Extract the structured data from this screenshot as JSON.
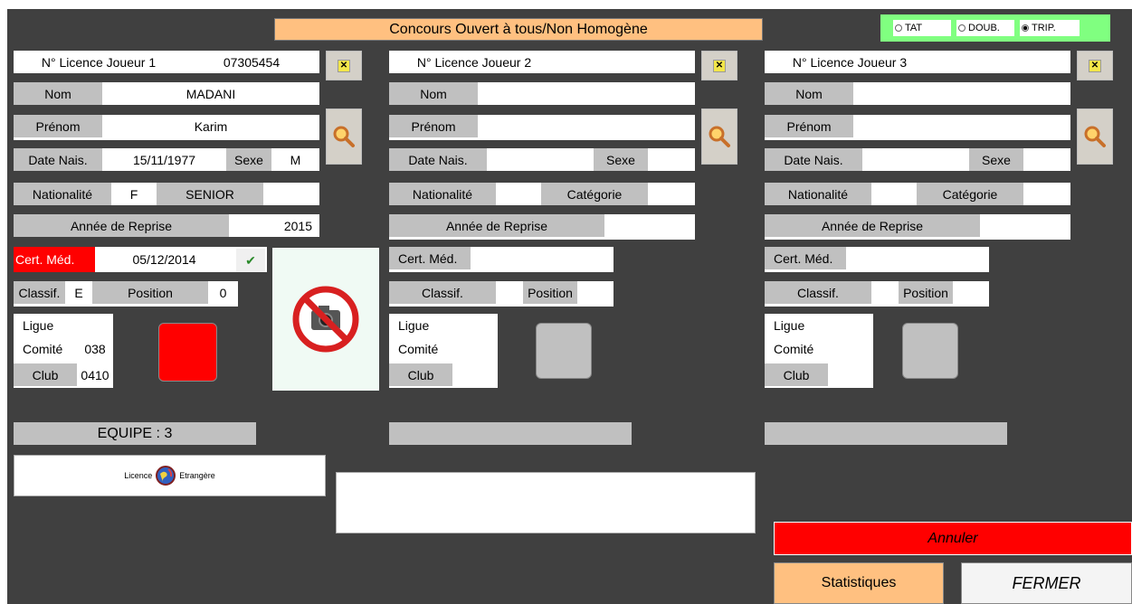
{
  "header": {
    "title": "Concours Ouvert à tous/Non Homogène",
    "modes": [
      {
        "label": "TAT",
        "selected": false
      },
      {
        "label": "DOUB.",
        "selected": false
      },
      {
        "label": "TRIP.",
        "selected": true
      }
    ]
  },
  "labels": {
    "nom": "Nom",
    "prenom": "Prénom",
    "date_nais": "Date Nais.",
    "sexe": "Sexe",
    "nationalite": "Nationalité",
    "categorie": "Catégorie",
    "annee_reprise": "Année de Reprise",
    "cert_med": "Cert. Méd.",
    "classif": "Classif.",
    "position": "Position",
    "ligue": "Ligue",
    "comite": "Comité",
    "club": "Club"
  },
  "players": [
    {
      "licence_label": "N° Licence Joueur 1",
      "licence": "07305454",
      "nom": "MADANI",
      "prenom": "Karim",
      "date_nais": "15/11/1977",
      "sexe": "M",
      "nationalite": "F",
      "categorie": "SENIOR",
      "annee_reprise": "2015",
      "cert_med": "05/12/2014",
      "classif": "E",
      "position": "0",
      "ligue": "",
      "comite": "038",
      "club": "0410",
      "status_color": "#ff0000",
      "equipe": "EQUIPE : 3"
    },
    {
      "licence_label": "N° Licence Joueur 2",
      "licence": "",
      "nom": "",
      "prenom": "",
      "date_nais": "",
      "sexe": "",
      "nationalite": "",
      "categorie": "",
      "annee_reprise": "",
      "cert_med": "",
      "classif": "",
      "position": "",
      "ligue": "",
      "comite": "",
      "club": "",
      "status_color": "#c0c0c0",
      "equipe": ""
    },
    {
      "licence_label": "N° Licence Joueur 3",
      "licence": "",
      "nom": "",
      "prenom": "",
      "date_nais": "",
      "sexe": "",
      "nationalite": "",
      "categorie": "",
      "annee_reprise": "",
      "cert_med": "",
      "classif": "",
      "position": "",
      "ligue": "",
      "comite": "",
      "club": "",
      "status_color": "#c0c0c0",
      "equipe": ""
    }
  ],
  "licence_etrangere": {
    "left": "Licence",
    "right": "Etrangère"
  },
  "photo": {
    "icon": "no-camera-icon"
  },
  "actions": {
    "annuler": "Annuler",
    "statistiques": "Statistiques",
    "fermer": "FERMER"
  },
  "colors": {
    "background": "#404040",
    "title_bg": "#ffc080",
    "radio_bg": "#80ff80",
    "alert_red": "#ff0000",
    "label_gray": "#c0c0c0",
    "stats_bg": "#ffc080"
  }
}
